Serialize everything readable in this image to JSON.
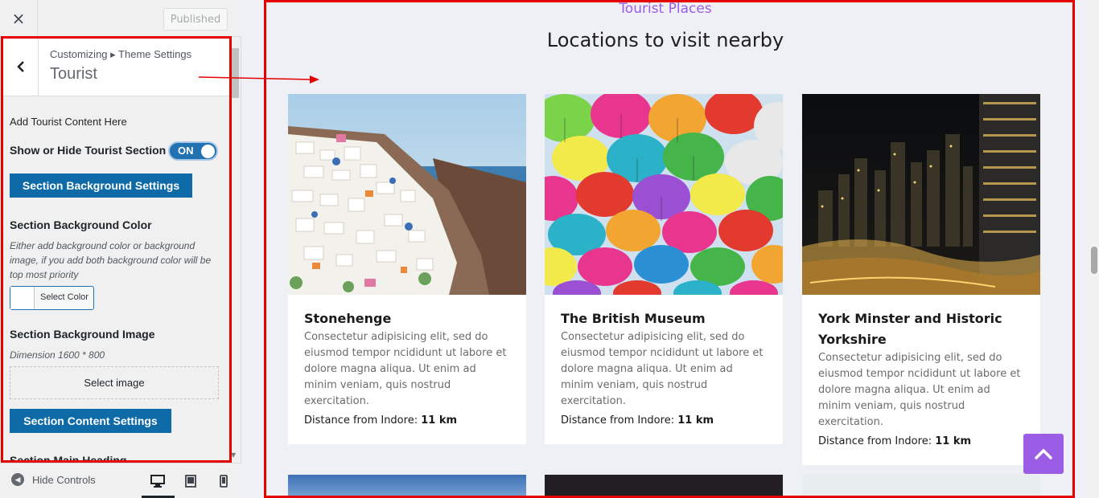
{
  "topbar": {
    "close_icon": "×",
    "published_label": "Published"
  },
  "panel": {
    "breadcrumb": "Customizing ▸ Theme Settings",
    "title": "Tourist",
    "add_content_label": "Add Tourist Content Here",
    "show_hide_label": "Show or Hide Tourist Section",
    "toggle_label": "ON",
    "bg_settings_button": "Section Background Settings",
    "bg_color_label": "Section Background Color",
    "bg_color_desc": "Either add background color or background image, if you add both background color will be top most priority",
    "select_color_label": "Select Color",
    "bg_image_label": "Section Background Image",
    "bg_image_desc": "Dimension 1600 * 800",
    "select_image_label": "Select image",
    "content_settings_button": "Section Content Settings",
    "main_heading_label": "Section Main Heading"
  },
  "footer": {
    "hide_controls_label": "Hide Controls"
  },
  "preview": {
    "eyebrow": "Tourist Places",
    "heading": "Locations to visit nearby",
    "cards": [
      {
        "title": "Stonehenge",
        "text": "Consectetur adipisicing elit, sed do eiusmod tempor ncididunt ut labore et dolore magna aliqua. Ut enim ad minim veniam, quis nostrud exercitation.",
        "distance_label": "Distance from Indore:",
        "distance_value": "11 km"
      },
      {
        "title": "The British Museum",
        "text": "Consectetur adipisicing elit, sed do eiusmod tempor ncididunt ut labore et dolore magna aliqua. Ut enim ad minim veniam, quis nostrud exercitation.",
        "distance_label": "Distance from Indore:",
        "distance_value": "11 km"
      },
      {
        "title": "York Minster and Historic Yorkshire",
        "text": "Consectetur adipisicing elit, sed do eiusmod tempor ncididunt ut labore et dolore magna aliqua. Ut enim ad minim veniam, quis nostrud exercitation.",
        "distance_label": "Distance from Indore:",
        "distance_value": "11 km"
      }
    ]
  },
  "colors": {
    "accent": "#9b5de5",
    "wp_blue": "#0f6aa8",
    "annotation_red": "#e50000"
  },
  "icons": [
    "close-icon",
    "back-icon",
    "hide-controls-icon",
    "desktop-icon",
    "tablet-icon",
    "mobile-icon",
    "chevron-up-icon"
  ]
}
